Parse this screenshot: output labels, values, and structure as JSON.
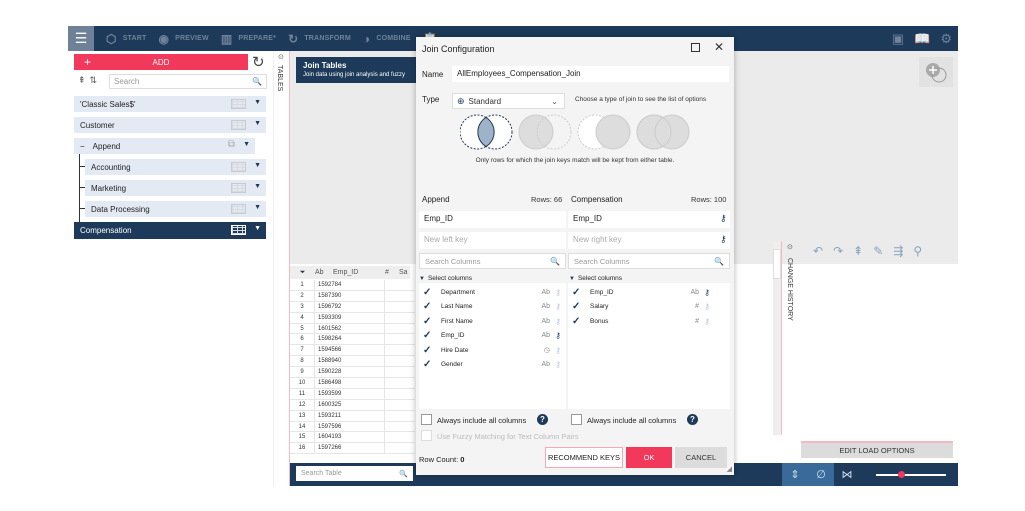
{
  "topbar": {
    "nav": [
      {
        "icon": "cube-icon",
        "label": "START"
      },
      {
        "icon": "eye-icon",
        "label": "PREVIEW"
      },
      {
        "icon": "columns-icon",
        "label": "PREPARE*"
      },
      {
        "icon": "transform-icon",
        "label": "TRANSFORM"
      },
      {
        "icon": "combine-icon",
        "label": "COMBINE"
      }
    ]
  },
  "sidebar": {
    "add_label": "ADD",
    "search_placeholder": "Search",
    "items": [
      {
        "label": "'Classic Sales$'"
      },
      {
        "label": "Customer"
      },
      {
        "label": "Append"
      },
      {
        "label": "Accounting"
      },
      {
        "label": "Marketing"
      },
      {
        "label": "Data Processing"
      },
      {
        "label": "Compensation"
      }
    ],
    "tables_label": "TABLES"
  },
  "canvas": {
    "card_title": "Join Tables",
    "card_subtitle": "Join data using join analysis and fuzzy"
  },
  "grid": {
    "col_type": "Ab",
    "col_name": "Emp_ID",
    "col2_type": "#",
    "col2_name": "Sa",
    "rows": [
      {
        "n": "1",
        "v": "1592784"
      },
      {
        "n": "2",
        "v": "1587390"
      },
      {
        "n": "3",
        "v": "1596792"
      },
      {
        "n": "4",
        "v": "1593309"
      },
      {
        "n": "5",
        "v": "1601562"
      },
      {
        "n": "6",
        "v": "1598264"
      },
      {
        "n": "7",
        "v": "1594566"
      },
      {
        "n": "8",
        "v": "1588940"
      },
      {
        "n": "9",
        "v": "1590228"
      },
      {
        "n": "10",
        "v": "1586498"
      },
      {
        "n": "11",
        "v": "1593599"
      },
      {
        "n": "12",
        "v": "1600325"
      },
      {
        "n": "13",
        "v": "1593211"
      },
      {
        "n": "14",
        "v": "1597596"
      },
      {
        "n": "15",
        "v": "1604193"
      },
      {
        "n": "16",
        "v": "1597266"
      }
    ],
    "search_placeholder": "Search Table"
  },
  "history": {
    "label": "CHANGE HISTORY",
    "edit_load_label": "EDIT LOAD OPTIONS"
  },
  "dialog": {
    "title": "Join Configuration",
    "name_label": "Name",
    "name_value": "AllEmployees_Compensation_Join",
    "type_label": "Type",
    "type_value": "Standard",
    "type_hint": "Choose a type of join to see the list of options",
    "join_desc": "Only rows for which the join keys match will be kept from either table.",
    "left": {
      "title": "Append",
      "rows": "Rows: 66",
      "key": "Emp_ID",
      "new_key_placeholder": "New left key",
      "search_placeholder": "Search Columns",
      "select_label": "Select columns",
      "columns": [
        {
          "name": "Department",
          "type": "Ab",
          "key": false
        },
        {
          "name": "Last Name",
          "type": "Ab",
          "key": false
        },
        {
          "name": "First Name",
          "type": "Ab",
          "key": false
        },
        {
          "name": "Emp_ID",
          "type": "Ab",
          "key": true
        },
        {
          "name": "Hire Date",
          "type": "◷",
          "key": false
        },
        {
          "name": "Gender",
          "type": "Ab",
          "key": false
        }
      ],
      "always_include": "Always include all columns"
    },
    "right": {
      "title": "Compensation",
      "rows": "Rows: 100",
      "key": "Emp_ID",
      "new_key_placeholder": "New right key",
      "search_placeholder": "Search Columns",
      "select_label": "Select columns",
      "columns": [
        {
          "name": "Emp_ID",
          "type": "Ab",
          "key": true
        },
        {
          "name": "Salary",
          "type": "#",
          "key": false
        },
        {
          "name": "Bonus",
          "type": "#",
          "key": false
        }
      ],
      "always_include": "Always include all columns"
    },
    "fuzzy_label": "Use Fuzzy Matching for Text Column Pairs",
    "row_count_label": "Row Count:",
    "row_count_value": "0",
    "recommend_label": "RECOMMEND KEYS",
    "ok_label": "OK",
    "cancel_label": "CANCEL"
  },
  "colors": {
    "navy": "#1d3a5a",
    "accent": "#f2385b"
  }
}
